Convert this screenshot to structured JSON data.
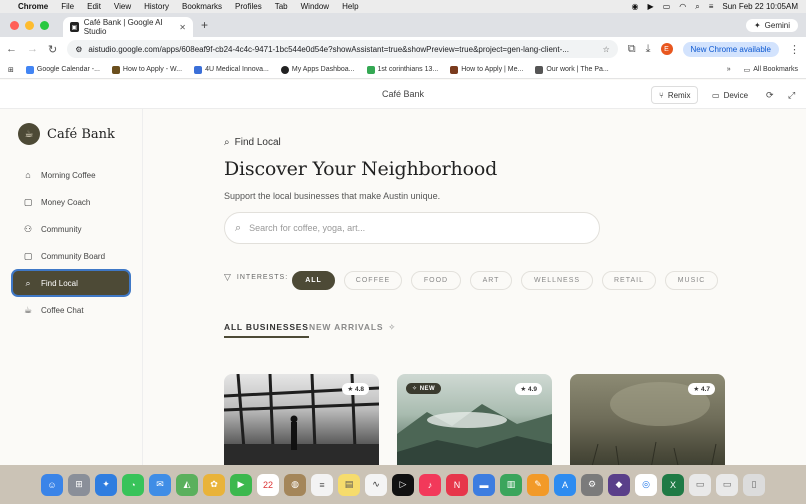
{
  "menubar": {
    "app": "Chrome",
    "items": [
      "File",
      "Edit",
      "View",
      "History",
      "Bookmarks",
      "Profiles",
      "Tab",
      "Window",
      "Help"
    ],
    "datetime": "Sun Feb 22  10:05AM"
  },
  "browser": {
    "tab_title": "Café Bank | Google AI Studio",
    "gemini_label": "Gemini",
    "url": "aistudio.google.com/apps/608eaf9f-cb24-4c4c-9471-1bc544e0d54e?showAssistant=true&showPreview=true&project=gen-lang-client-...",
    "profile_initial": "E",
    "new_chrome_label": "New Chrome available",
    "bookmarks": [
      {
        "label": "Google Calendar -...",
        "color": "#4285f4"
      },
      {
        "label": "How to Apply - W...",
        "color": "#6b4f1d"
      },
      {
        "label": "4U Medical Innova...",
        "color": "#3b6fd8"
      },
      {
        "label": "My Apps Dashboa...",
        "color": "#222222"
      },
      {
        "label": "1st corinthians 13...",
        "color": "#34a853"
      },
      {
        "label": "How to Apply | Me...",
        "color": "#7a3b1d"
      },
      {
        "label": "Our work | The Pa...",
        "color": "#555555"
      }
    ],
    "all_bookmarks": "All Bookmarks"
  },
  "app_header": {
    "title": "Café Bank",
    "remix_label": "Remix",
    "device_label": "Device"
  },
  "sidebar": {
    "brand": "Café Bank",
    "items": [
      {
        "label": "Morning Coffee",
        "icon": "home-icon"
      },
      {
        "label": "Money Coach",
        "icon": "chat-icon"
      },
      {
        "label": "Community",
        "icon": "users-icon"
      },
      {
        "label": "Community Board",
        "icon": "board-icon"
      },
      {
        "label": "Find Local",
        "icon": "search-icon",
        "active": true
      },
      {
        "label": "Coffee Chat",
        "icon": "cup-icon"
      }
    ]
  },
  "main": {
    "eyebrow": "Find Local",
    "heading": "Discover Your Neighborhood",
    "subheading": "Support the local businesses that make Austin unique.",
    "search_placeholder": "Search for coffee, yoga, art...",
    "interests_label": "INTERESTS:",
    "chips": [
      "ALL",
      "COFFEE",
      "FOOD",
      "ART",
      "WELLNESS",
      "RETAIL",
      "MUSIC"
    ],
    "active_chip": "ALL",
    "section_tabs": [
      "ALL BUSINESSES",
      "NEW ARRIVALS"
    ],
    "cards": [
      {
        "rating": "4.8",
        "new": ""
      },
      {
        "rating": "4.9",
        "new": "NEW"
      },
      {
        "rating": "4.7",
        "new": ""
      }
    ]
  },
  "colors": {
    "accent": "#4d4a36",
    "active_outline": "#3f78c6",
    "chrome_blue": "#0b57d0"
  }
}
